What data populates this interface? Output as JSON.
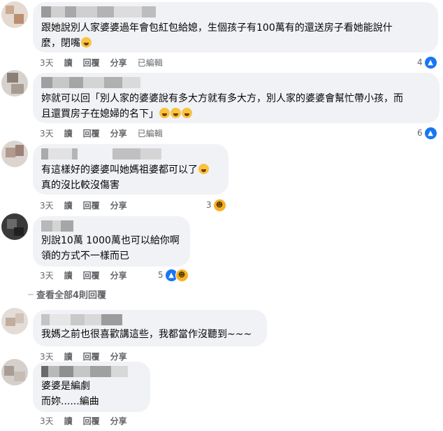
{
  "comments": [
    {
      "lines": [
        "跟她說別人家婆婆過年會包紅包給媳，生個孩子有100萬有的還送房子看她能說什",
        "麼，閉嘴"
      ],
      "time": "3天",
      "read": "讀",
      "reply": "回覆",
      "share": "分享",
      "edited": "已編輯",
      "reaction_count": "4"
    },
    {
      "lines": [
        "妳就可以回「別人家的婆婆說有多大方就有多大方，別人家的婆婆會幫忙帶小孩，而",
        "且還買房子在媳婦的名下」"
      ],
      "time": "3天",
      "read": "讀",
      "reply": "回覆",
      "share": "分享",
      "edited": "已編輯",
      "reaction_count": "6"
    },
    {
      "lines": [
        "有這樣好的婆婆叫她媽祖婆都可以了",
        "真的沒比較沒傷害"
      ],
      "time": "3天",
      "read": "讀",
      "reply": "回覆",
      "share": "分享",
      "reaction_count": "3"
    },
    {
      "lines": [
        "別說10萬 1000萬也可以給你啊",
        "領的方式不一樣而已"
      ],
      "time": "3天",
      "read": "讀",
      "reply": "回覆",
      "share": "分享",
      "reaction_count": "5"
    },
    {
      "lines": [
        "我媽之前也很喜歡講這些，我都當作沒聽到~~~"
      ],
      "time": "3天",
      "read": "讀",
      "reply": "回覆",
      "share": "分享"
    },
    {
      "lines": [
        "婆婆是編劇",
        "而妳......編曲"
      ],
      "time": "3天",
      "read": "讀",
      "reply": "回覆",
      "share": "分享"
    }
  ],
  "view_all_replies": "查看全部4則回覆",
  "icons": {
    "like": "thumbs-up-icon",
    "haha": "laughing-face-icon",
    "tired": "tired-face-icon"
  },
  "colors": {
    "bubble": "#f0f2f5",
    "meta": "#65676b",
    "like": "#1877f2"
  }
}
